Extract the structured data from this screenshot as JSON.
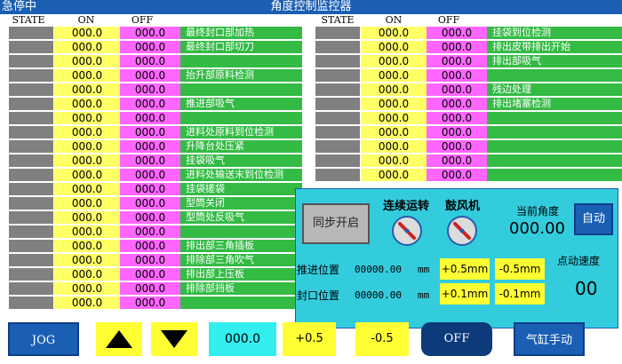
{
  "title_bar": {
    "status": "急停中",
    "title": "角度控制监控器"
  },
  "headers": {
    "state": "STATE",
    "on": "ON",
    "off": "OFF"
  },
  "left_rows": [
    {
      "on": "000.0",
      "off": "000.0",
      "desc": "最终封口部加热"
    },
    {
      "on": "000.0",
      "off": "000.0",
      "desc": "最终封口部切刀"
    },
    {
      "on": "000.0",
      "off": "000.0",
      "desc": ""
    },
    {
      "on": "000.0",
      "off": "000.0",
      "desc": "抬升部原料检测"
    },
    {
      "on": "000.0",
      "off": "000.0",
      "desc": ""
    },
    {
      "on": "000.0",
      "off": "000.0",
      "desc": "推进部吸气"
    },
    {
      "on": "000.0",
      "off": "000.0",
      "desc": ""
    },
    {
      "on": "000.0",
      "off": "000.0",
      "desc": "进料处原料到位检测"
    },
    {
      "on": "000.0",
      "off": "000.0",
      "desc": "升降台处压紧"
    },
    {
      "on": "000.0",
      "off": "000.0",
      "desc": "挂袋吸气"
    },
    {
      "on": "000.0",
      "off": "000.0",
      "desc": "进料处输送末到位检测"
    },
    {
      "on": "000.0",
      "off": "000.0",
      "desc": "挂袋搓袋"
    },
    {
      "on": "000.0",
      "off": "000.0",
      "desc": "型筒关闭"
    },
    {
      "on": "000.0",
      "off": "000.0",
      "desc": "型筒处反吸气"
    },
    {
      "on": "000.0",
      "off": "000.0",
      "desc": ""
    },
    {
      "on": "000.0",
      "off": "000.0",
      "desc": "排出部三角插板"
    },
    {
      "on": "000.0",
      "off": "000.0",
      "desc": "排除部三角吹气"
    },
    {
      "on": "000.0",
      "off": "000.0",
      "desc": "排出部上压板"
    },
    {
      "on": "000.0",
      "off": "000.0",
      "desc": "排除部挡板"
    },
    {
      "on": "000.0",
      "off": "000.0",
      "desc": ""
    }
  ],
  "right_rows": [
    {
      "on": "000.0",
      "off": "000.0",
      "desc": "挂袋到位检测"
    },
    {
      "on": "000.0",
      "off": "000.0",
      "desc": "排出皮带排出开始"
    },
    {
      "on": "000.0",
      "off": "000.0",
      "desc": "排出部吸气"
    },
    {
      "on": "000.0",
      "off": "000.0",
      "desc": ""
    },
    {
      "on": "000.0",
      "off": "000.0",
      "desc": "残边处理"
    },
    {
      "on": "000.0",
      "off": "000.0",
      "desc": "排出堵塞检测"
    },
    {
      "on": "000.0",
      "off": "000.0",
      "desc": ""
    },
    {
      "on": "000.0",
      "off": "000.0",
      "desc": ""
    },
    {
      "on": "000.0",
      "off": "000.0",
      "desc": ""
    },
    {
      "on": "000.0",
      "off": "000.0",
      "desc": ""
    },
    {
      "on": "000.0",
      "off": "000.0",
      "desc": ""
    }
  ],
  "panel": {
    "sync_button": "同步开启",
    "continuous_label": "连续运转",
    "blower_label": "鼓风机",
    "current_angle_label": "当前角度",
    "current_angle_value": "000.00",
    "auto_button": "自动",
    "push_pos_label": "推进位置",
    "push_pos_value": "00000.00",
    "seal_pos_label": "封口位置",
    "seal_pos_value": "00000.00",
    "unit": "mm",
    "plus_05": "+0.5mm",
    "minus_05": "-0.5mm",
    "plus_01": "+0.1mm",
    "minus_01": "-0.1mm",
    "jog_speed_label": "点动速度",
    "jog_speed_value": "00"
  },
  "toolbar": {
    "jog": "JOG",
    "value": "000.0",
    "plus": "+0.5",
    "minus": "-0.5",
    "off": "OFF",
    "cylinder_manual": "气缸手动"
  },
  "colors": {
    "title_bg": "#1a5fb4",
    "state": "#808080",
    "on": "#ffff66",
    "off": "#ff66ff",
    "desc": "#33bb44",
    "panel": "#33ccdd",
    "blue_button": "#1a5fb4",
    "navy_button": "#0d3a7a"
  }
}
